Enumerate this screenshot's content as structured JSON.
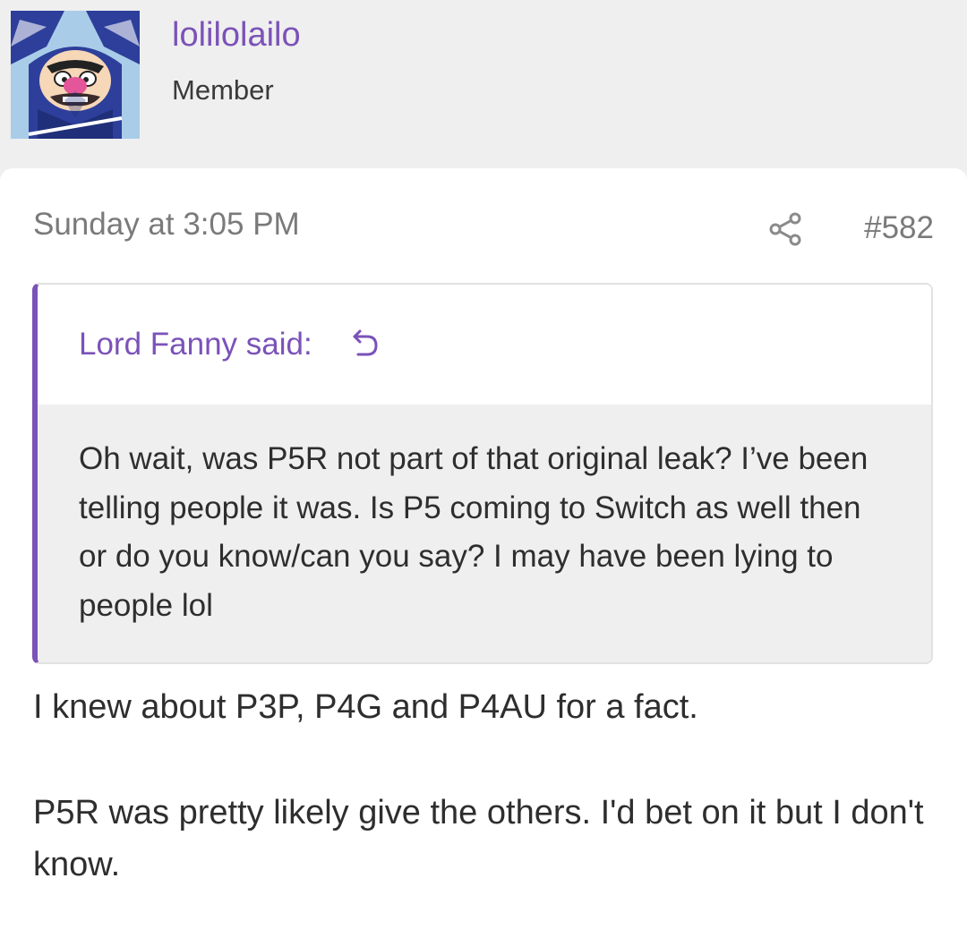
{
  "author": {
    "username": "lolilolailo",
    "title": "Member",
    "avatar_icon": "wario-avatar-icon"
  },
  "post": {
    "date": "Sunday at 3:05 PM",
    "number": "#582",
    "share_icon": "share-icon",
    "quote": {
      "author_label": "Lord Fanny said:",
      "jump_icon": "return-arrow-icon",
      "text": "Oh wait, was P5R not part of that original leak? I’ve been telling people it was. Is P5 coming to Switch as well then or do you know/can you say? I may have been lying to people lol"
    },
    "body": [
      "I knew about P3P, P4G and P4AU for a fact.",
      "P5R was pretty likely give the others. I'd bet on it but I don't know."
    ]
  },
  "colors": {
    "accent": "#7b52b8",
    "page_bg": "#efefef",
    "card_bg": "#ffffff",
    "muted_text": "#7a7a7a",
    "body_text": "#2e2e2e"
  }
}
